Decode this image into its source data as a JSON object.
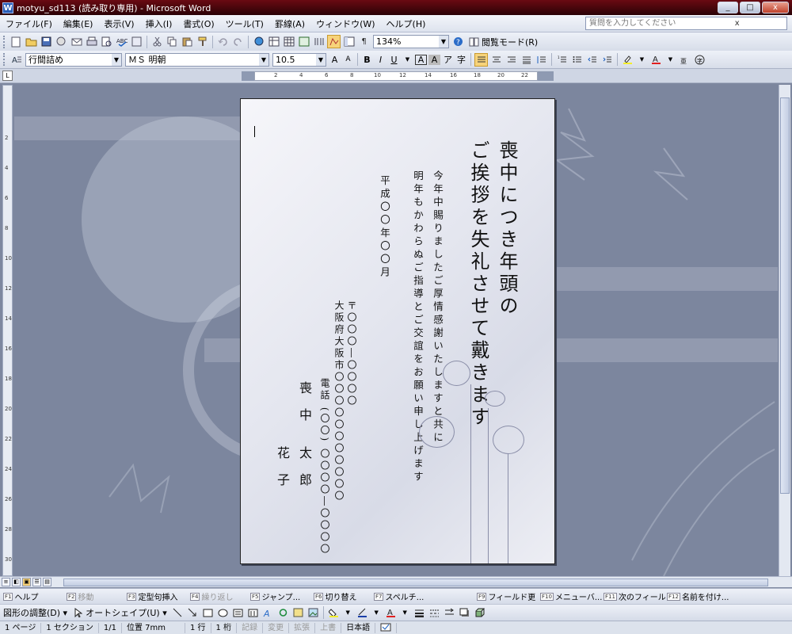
{
  "window": {
    "title": "motyu_sd113 (読み取り専用) - Microsoft Word",
    "app_icon": "W",
    "minimize": "_",
    "maximize": "□",
    "close": "x"
  },
  "menu": {
    "items": [
      "ファイル(F)",
      "編集(E)",
      "表示(V)",
      "挿入(I)",
      "書式(O)",
      "ツール(T)",
      "罫線(A)",
      "ウィンドウ(W)",
      "ヘルプ(H)"
    ],
    "help_placeholder": "質問を入力してください",
    "close_doc": "x"
  },
  "standard_toolbar": {
    "zoom": "134%",
    "reading_mode": "閲覧モード(R)"
  },
  "format_toolbar": {
    "style": "行間詰め",
    "font": "ＭＳ 明朝",
    "font_size": "10.5",
    "bold": "B",
    "italic": "I",
    "underline": "U"
  },
  "ruler": {
    "corner": "L",
    "ticks": [
      "2",
      "4",
      "6",
      "8",
      "10",
      "12",
      "14",
      "16",
      "18",
      "20",
      "22"
    ],
    "vticks": [
      "2",
      "4",
      "6",
      "8",
      "10",
      "12",
      "14",
      "16",
      "18",
      "20",
      "22",
      "24",
      "26",
      "28",
      "30"
    ]
  },
  "document": {
    "heading_col1": "喪中につき年頭の",
    "heading_col2": "ご挨拶を失礼させて戴きます",
    "body_col1": "今年中賜りましたご厚情感謝いたしますと共に",
    "body_col2": "明年もかわらぬご指導とご交誼をお願い申し上げます",
    "date": "平成〇〇年〇〇月",
    "postal": "〒〇〇〇―〇〇〇〇",
    "address": "大阪府大阪市〇〇〇〇〇〇〇〇〇〇〇",
    "phone": "電話 (〇〇) 〇〇〇〇―〇〇〇〇",
    "name_family": "喪中",
    "name_given": "太郎",
    "name_spouse": "花子"
  },
  "function_keys": [
    {
      "key": "F1",
      "label": "ヘルプ",
      "enabled": true
    },
    {
      "key": "F2",
      "label": "移動",
      "enabled": false
    },
    {
      "key": "F3",
      "label": "定型句挿入",
      "enabled": true
    },
    {
      "key": "F4",
      "label": "繰り返し",
      "enabled": false
    },
    {
      "key": "F5",
      "label": "ジャンプ...",
      "enabled": true
    },
    {
      "key": "F6",
      "label": "切り替え",
      "enabled": true
    },
    {
      "key": "F7",
      "label": "スペルチ...",
      "enabled": true
    },
    {
      "key": "F9",
      "label": "フィールド更",
      "enabled": true
    },
    {
      "key": "F10",
      "label": "メニューバ...",
      "enabled": true
    },
    {
      "key": "F11",
      "label": "次のフィール",
      "enabled": true
    },
    {
      "key": "F12",
      "label": "名前を付け...",
      "enabled": true
    }
  ],
  "drawing_toolbar": {
    "draw_menu": "図形の調整(D) ▾",
    "autoshape": "オートシェイプ(U) ▾"
  },
  "status": {
    "page": "1 ページ",
    "section": "1 セクション",
    "pages": "1/1",
    "position": "位置 7mm",
    "line": "1 行",
    "column": "1 桁",
    "rec": "記録",
    "trk": "変更",
    "ext": "拡張",
    "ovr": "上書",
    "language": "日本語"
  },
  "colors": {
    "titlebar": "#4a0610",
    "workspace": "#7c869e",
    "page": "#f6f6fa"
  }
}
